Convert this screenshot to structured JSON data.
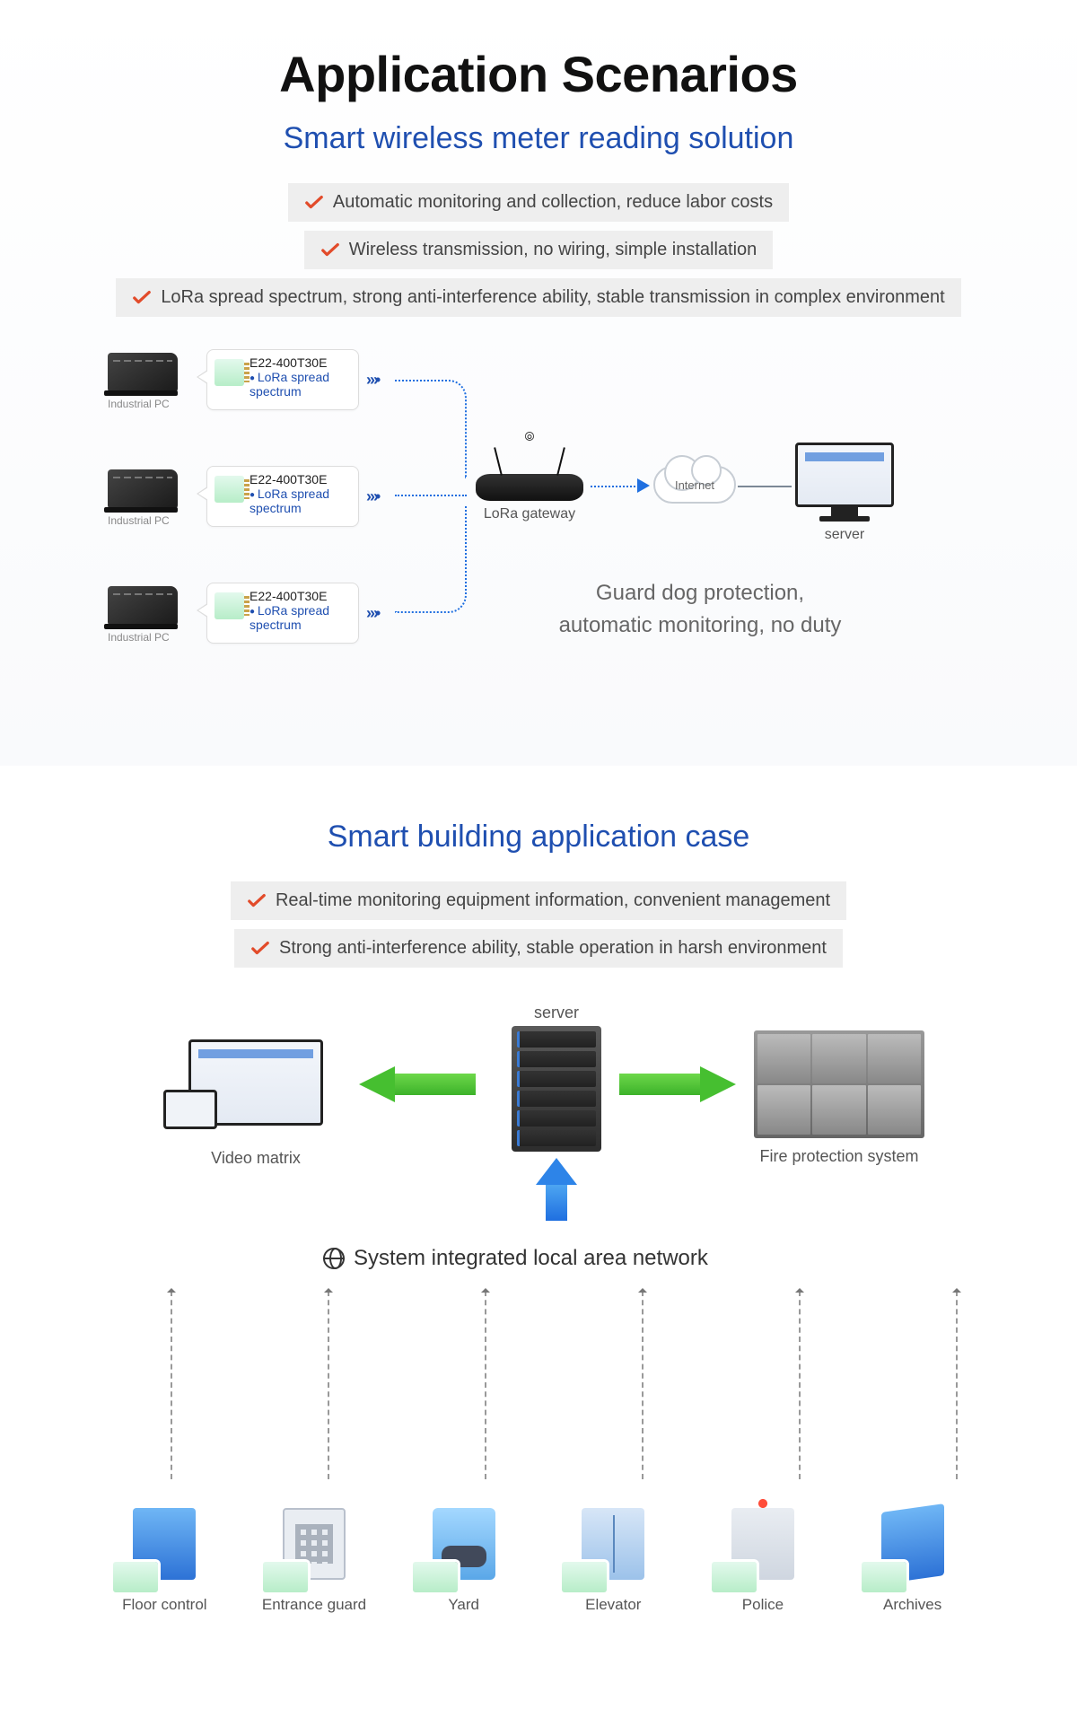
{
  "main_title": "Application Scenarios",
  "scenario1": {
    "title": "Smart wireless meter reading solution",
    "features": [
      "Automatic monitoring and collection, reduce labor costs",
      "Wireless transmission, no wiring, simple installation",
      "LoRa spread spectrum, strong anti-interference ability, stable transmission in complex environment"
    ],
    "pc_label": "Industrial PC",
    "module_model": "E22-400T30E",
    "module_mode": "LoRa spread spectrum",
    "gateway_label": "LoRa gateway",
    "cloud_label": "Internet",
    "server_label": "server",
    "tagline_l1": "Guard dog protection,",
    "tagline_l2": "automatic monitoring, no duty"
  },
  "scenario2": {
    "title": "Smart building application case",
    "features": [
      "Real-time monitoring equipment information, convenient management",
      "Strong anti-interference ability, stable operation in harsh environment"
    ],
    "video_matrix_label": "Video matrix",
    "server_label": "server",
    "fire_label": "Fire protection system",
    "lan_title": "System integrated local area network",
    "nodes": [
      {
        "label": "Floor control",
        "icon": "tower"
      },
      {
        "label": "Entrance guard",
        "icon": "keypad"
      },
      {
        "label": "Yard",
        "icon": "car"
      },
      {
        "label": "Elevator",
        "icon": "elev"
      },
      {
        "label": "Police",
        "icon": "police"
      },
      {
        "label": "Archives",
        "icon": "archive"
      }
    ]
  }
}
